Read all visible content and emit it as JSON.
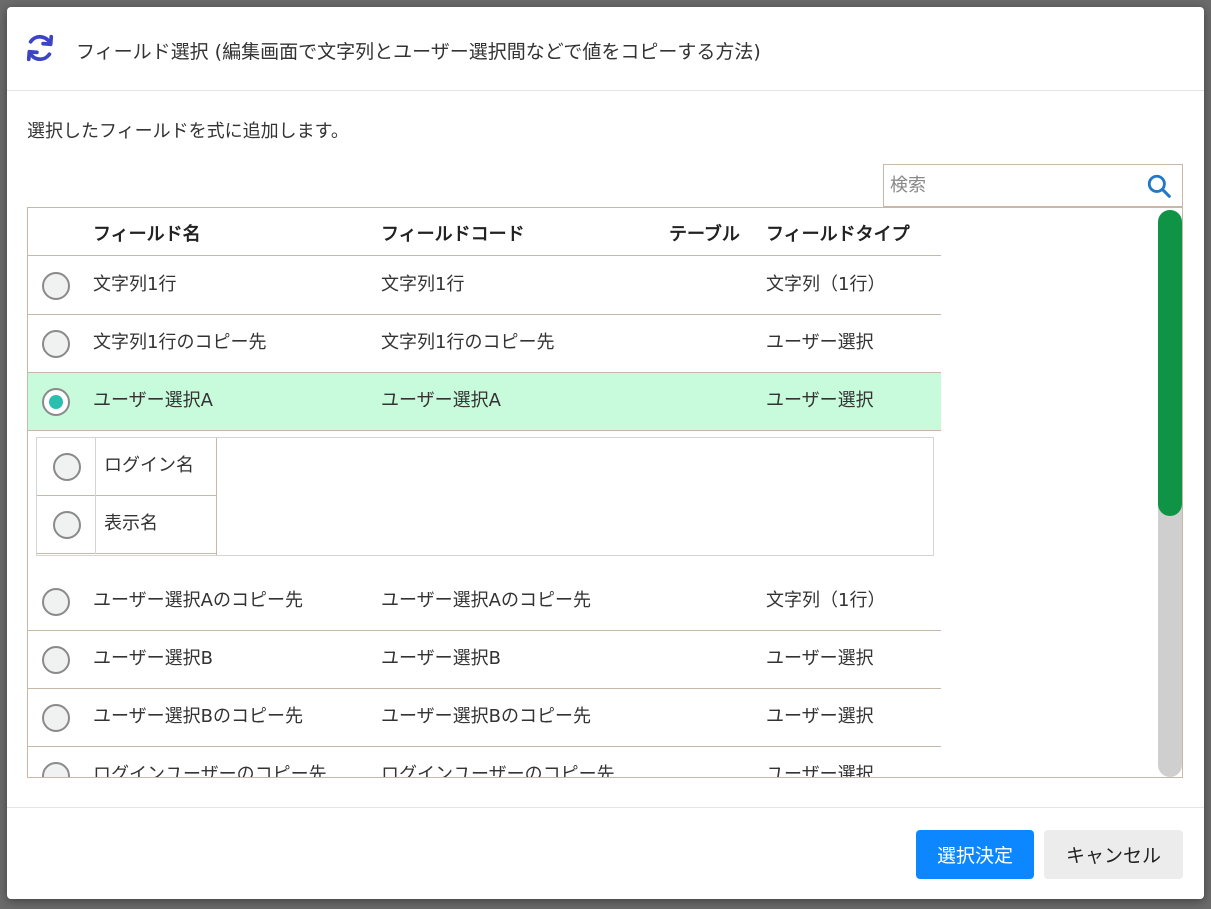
{
  "dialog": {
    "title": "フィールド選択 (編集画面で文字列とユーザー選択間などで値をコピーする方法)",
    "description": "選択したフィールドを式に追加します。",
    "icon": "refresh-icon",
    "accent_color": "#3b44c4"
  },
  "search": {
    "placeholder": "検索",
    "value": "",
    "icon": "search-icon",
    "icon_color": "#1f78c8"
  },
  "table": {
    "columns": [
      "フィールド名",
      "フィールドコード",
      "テーブル",
      "フィールドタイプ"
    ],
    "rows": [
      {
        "name": "文字列1行",
        "code": "文字列1行",
        "table": "",
        "type": "文字列（1行）",
        "selected": false
      },
      {
        "name": "文字列1行のコピー先",
        "code": "文字列1行のコピー先",
        "table": "",
        "type": "ユーザー選択",
        "selected": false
      },
      {
        "name": "ユーザー選択A",
        "code": "ユーザー選択A",
        "table": "",
        "type": "ユーザー選択",
        "selected": true
      },
      {
        "name": "ユーザー選択Aのコピー先",
        "code": "ユーザー選択Aのコピー先",
        "table": "",
        "type": "文字列（1行）",
        "selected": false
      },
      {
        "name": "ユーザー選択B",
        "code": "ユーザー選択B",
        "table": "",
        "type": "ユーザー選択",
        "selected": false
      },
      {
        "name": "ユーザー選択Bのコピー先",
        "code": "ユーザー選択Bのコピー先",
        "table": "",
        "type": "ユーザー選択",
        "selected": false
      },
      {
        "name": "ログインユーザーのコピー先",
        "code": "ログインユーザーのコピー先",
        "table": "",
        "type": "ユーザー選択",
        "selected": false
      }
    ],
    "sub_options": [
      {
        "label": "ログイン名",
        "selected": false
      },
      {
        "label": "表示名",
        "selected": false
      }
    ],
    "selected_row_color": "#c8fadc",
    "scroll_position": 0.0,
    "scroll_visible_fraction": 0.54,
    "scrollbar_color": "#0e9444"
  },
  "footer": {
    "confirm_label": "選択決定",
    "cancel_label": "キャンセル",
    "confirm_color": "#0d87ff"
  }
}
